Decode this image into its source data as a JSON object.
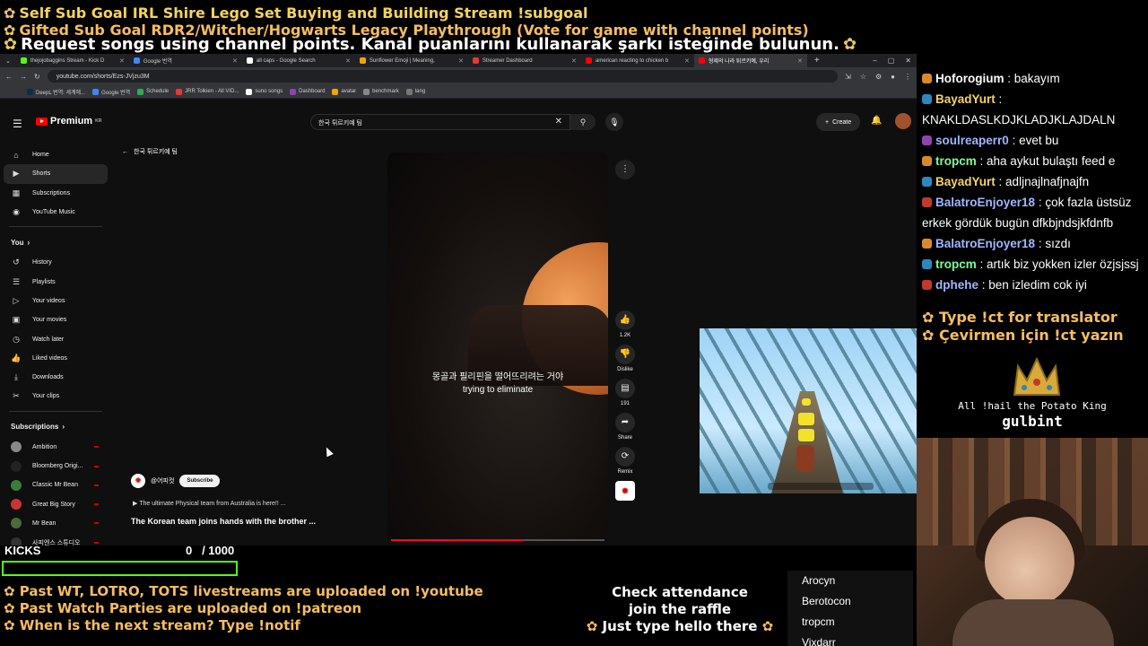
{
  "overlay_top": {
    "line1": "Self Sub Goal IRL Shire Lego Set Buying and Building Stream !subgoal",
    "line2": "Gifted Sub Goal RDR2/Witcher/Hogwarts Legacy Playthrough (Vote for game with channel points)",
    "line3": "Request songs using channel points. Kanal puanlarını kullanarak şarkı isteğinde bulunun."
  },
  "browser": {
    "tabs": [
      {
        "label": "thejojobaggins Stream - Kick D",
        "color": "#53fc18",
        "active": false
      },
      {
        "label": "Google 번역",
        "color": "#4285f4",
        "active": false
      },
      {
        "label": "all caps - Google Search",
        "color": "#ffffff",
        "active": false
      },
      {
        "label": "Sunflower Emoji | Meaning,",
        "color": "#f4a300",
        "active": false
      },
      {
        "label": "Streamer Dashboard",
        "color": "#e53935",
        "active": false
      },
      {
        "label": "american reacting to chicken b",
        "color": "#ff0000",
        "active": false
      },
      {
        "label": "형제의 나라 튀르키예, 우리",
        "color": "#ff0000",
        "active": true
      }
    ],
    "url": "youtube.com/shorts/Ezs-JVjzu3M",
    "bookmarks": [
      "DeepL 번역: 세계에...",
      "Google 번역",
      "Schedule",
      "JRR Tolkien - All VID...",
      "suno songs",
      "Dashboard",
      "avatar",
      "benchmark",
      "lang"
    ]
  },
  "youtube": {
    "logo_text": "Premium",
    "logo_region": "KR",
    "search_value": "한국 튀르키예 팀",
    "create_label": "Create",
    "sidebar": {
      "main": [
        {
          "label": "Home",
          "icon": "home-icon"
        },
        {
          "label": "Shorts",
          "icon": "shorts-icon",
          "active": true
        },
        {
          "label": "Subscriptions",
          "icon": "subscriptions-icon"
        },
        {
          "label": "YouTube Music",
          "icon": "music-icon"
        }
      ],
      "you_heading": "You",
      "you": [
        {
          "label": "History",
          "icon": "history-icon"
        },
        {
          "label": "Playlists",
          "icon": "playlists-icon"
        },
        {
          "label": "Your videos",
          "icon": "videos-icon"
        },
        {
          "label": "Your movies",
          "icon": "movies-icon"
        },
        {
          "label": "Watch later",
          "icon": "watch-later-icon"
        },
        {
          "label": "Liked videos",
          "icon": "like-icon"
        },
        {
          "label": "Downloads",
          "icon": "download-icon"
        },
        {
          "label": "Your clips",
          "icon": "clips-icon"
        }
      ],
      "subs_heading": "Subscriptions",
      "subs": [
        {
          "label": "Ambition",
          "color": "#888"
        },
        {
          "label": "Bloomberg Origi...",
          "color": "#222"
        },
        {
          "label": "Classic Mr Bean",
          "color": "#3b7d3b"
        },
        {
          "label": "Great Big Story",
          "color": "#c33"
        },
        {
          "label": "Mr Bean",
          "color": "#4a6a3a"
        },
        {
          "label": "사피엔스 스튜디오",
          "color": "#333"
        }
      ]
    },
    "shorts": {
      "back_title": "한국 튀르키예 팀",
      "subtitle_kr": "몽골과 필리핀을 떨어뜨리려는 거야",
      "subtitle_en": "trying to eliminate",
      "progress": 0.62,
      "channel": "@어피컷",
      "subscribe": "Subscribe",
      "desc1": "The ultimate Physical team from Australia is here!! ...",
      "desc2": "The Korean team joins hands with the brother ...",
      "actions": {
        "likes": "1.2K",
        "dislike": "Dislike",
        "comments": "191",
        "share": "Share",
        "remix": "Remix"
      }
    }
  },
  "kicks": {
    "label": "KICKS",
    "count": "0",
    "goal": "/ 1000",
    "progress": 0
  },
  "overlay_bottom": {
    "line1": "Past WT, LOTRO, TOTS livestreams are uploaded on !youtube",
    "line2": "Past Watch Parties are uploaded on !patreon",
    "line3": "When is the next stream? Type !notif",
    "attendance1": "Check attendance",
    "attendance2": "join the raffle",
    "attendance3": "Just type hello there"
  },
  "raffle_names": [
    "Arocyn",
    "Berotocon",
    "tropcm",
    "Vixdarr"
  ],
  "chat": [
    {
      "user": "Hoforogium",
      "text": ": bakayım",
      "color": "#ffffff"
    },
    {
      "user": "BayadYurt",
      "text": ":",
      "color": "#f6d365"
    },
    {
      "user": "",
      "text": "KNAKLDASLKDJKLADJKLAJDALN",
      "color": "#ffffff"
    },
    {
      "user": "soulreaperr0",
      "text": ": evet bu",
      "color": "#9fb6ff"
    },
    {
      "user": "tropcm",
      "text": ": aha aykut bulaştı feed e",
      "color": "#7cfc9a"
    },
    {
      "user": "BayadYurt",
      "text": ": adljnajlnafjnajfn",
      "color": "#f6d365"
    },
    {
      "user": "BalatroEnjoyer18",
      "text": ": çok fazla üstsüz",
      "color": "#9fb6ff"
    },
    {
      "user": "",
      "text": "erkek gördük bugün dfkbjndsjkfdnfb",
      "color": "#ffffff"
    },
    {
      "user": "BalatroEnjoyer18",
      "text": ": sızdı",
      "color": "#9fb6ff"
    },
    {
      "user": "tropcm",
      "text": ": artık biz yokken izler özjsjssj",
      "color": "#7cfc9a"
    },
    {
      "user": "dphehe",
      "text": ": ben izledim cok iyi",
      "color": "#9fb6ff"
    }
  ],
  "translator": {
    "line1": "Type !ct for translator",
    "line2": "Çevirmen için !ct yazın"
  },
  "king": {
    "line": "All !hail the Potato King",
    "name": "gulbint"
  }
}
